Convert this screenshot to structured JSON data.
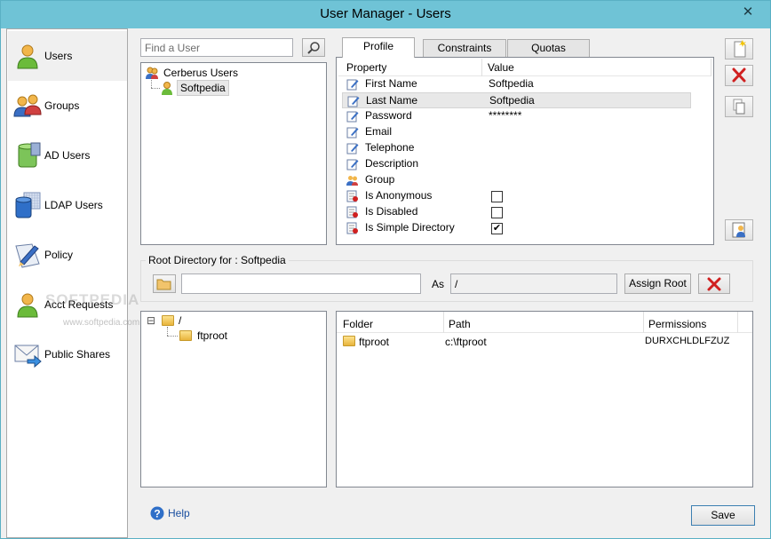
{
  "window": {
    "title": "User Manager - Users",
    "close_glyph": "✕"
  },
  "sidebar": {
    "items": [
      {
        "label": "Users",
        "icon": "user-icon",
        "selected": true
      },
      {
        "label": "Groups",
        "icon": "group-icon",
        "selected": false
      },
      {
        "label": "AD Users",
        "icon": "ad-database-icon",
        "selected": false
      },
      {
        "label": "LDAP Users",
        "icon": "ldap-database-icon",
        "selected": false
      },
      {
        "label": "Policy",
        "icon": "policy-pen-icon",
        "selected": false
      },
      {
        "label": "Acct Requests",
        "icon": "account-request-icon",
        "selected": false
      },
      {
        "label": "Public Shares",
        "icon": "public-share-envelope-icon",
        "selected": false
      }
    ]
  },
  "search": {
    "placeholder": "Find a User",
    "value": ""
  },
  "user_tree": {
    "root": "Cerberus Users",
    "child": "Softpedia"
  },
  "tabs": [
    {
      "label": "Profile",
      "active": true
    },
    {
      "label": "Constraints",
      "active": false
    },
    {
      "label": "Quotas",
      "active": false
    }
  ],
  "property_grid": {
    "headers": {
      "property": "Property",
      "value": "Value"
    },
    "rows": [
      {
        "name": "First Name",
        "value": "Softpedia",
        "type": "text"
      },
      {
        "name": "Last Name",
        "value": "Softpedia",
        "type": "text"
      },
      {
        "name": "Password",
        "value": "********",
        "type": "text"
      },
      {
        "name": "Email",
        "value": "",
        "type": "text"
      },
      {
        "name": "Telephone",
        "value": "",
        "type": "text"
      },
      {
        "name": "Description",
        "value": "",
        "type": "text"
      },
      {
        "name": "Group",
        "value": "",
        "type": "group"
      },
      {
        "name": "Is Anonymous",
        "checked": false,
        "type": "bool"
      },
      {
        "name": "Is Disabled",
        "checked": false,
        "type": "bool"
      },
      {
        "name": "Is Simple Directory",
        "checked": true,
        "type": "bool"
      }
    ]
  },
  "root_dir": {
    "label": "Root Directory for : Softpedia",
    "path_value": "",
    "as_label": "As",
    "as_value": "/",
    "assign_button": "Assign Root"
  },
  "folder_tree": {
    "root": "/",
    "child": "ftproot",
    "expander": "⊟"
  },
  "folder_table": {
    "headers": [
      "Folder",
      "Path",
      "Permissions"
    ],
    "rows": [
      {
        "folder": "ftproot",
        "path": "c:\\ftproot",
        "permissions": "DURXCHLDLFZUZ"
      }
    ]
  },
  "footer": {
    "help_label": "Help",
    "save_label": "Save"
  },
  "watermark": {
    "brand": "SOFTPEDIA",
    "url": "www.softpedia.com"
  },
  "colors": {
    "titlebar": "#6fc3d6",
    "selection": "#e8e8e8",
    "delete_red": "#d02020"
  }
}
